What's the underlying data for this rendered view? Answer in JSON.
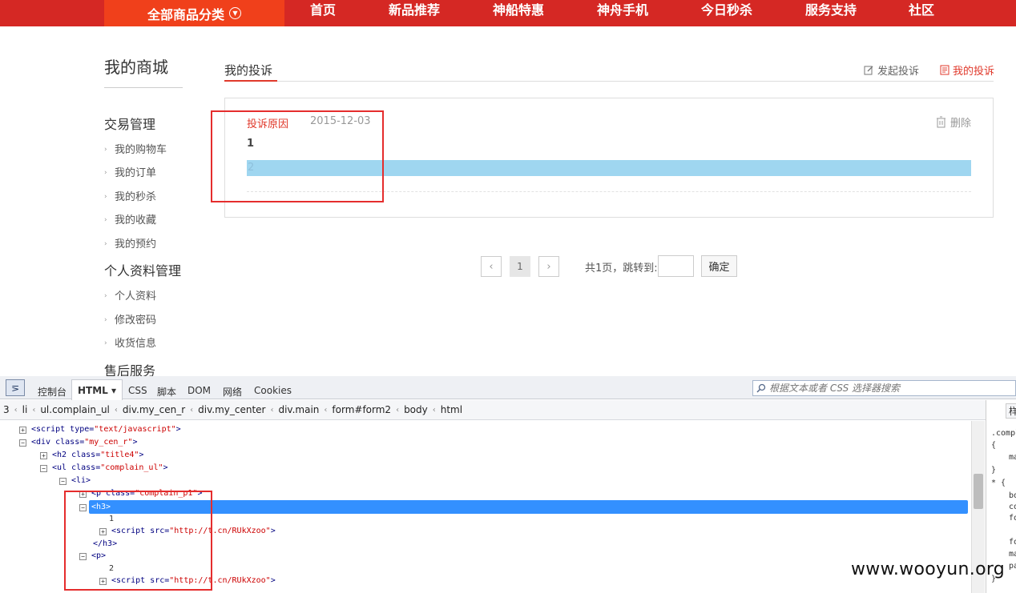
{
  "topnav": {
    "category_label": "全部商品分类",
    "items": [
      "首页",
      "新品推荐",
      "神船特惠",
      "神舟手机",
      "今日秒杀",
      "服务支持",
      "社区"
    ]
  },
  "sidebar": {
    "title": "我的商城",
    "groups": [
      {
        "title": "交易管理",
        "items": [
          "我的购物车",
          "我的订单",
          "我的秒杀",
          "我的收藏",
          "我的预约"
        ]
      },
      {
        "title": "个人资料管理",
        "items": [
          "个人资料",
          "修改密码",
          "收货信息"
        ]
      },
      {
        "title": "售后服务",
        "items": []
      }
    ]
  },
  "main": {
    "title": "我的投诉",
    "actions": {
      "create": "发起投诉",
      "mine": "我的投诉"
    },
    "complaint": {
      "reason_label": "投诉原因",
      "date": "2015-12-03",
      "delete_label": "删除",
      "h3_text": "1",
      "p_text": "2"
    }
  },
  "pagination": {
    "prev": "‹",
    "next": "›",
    "current": "1",
    "info": "共1页，跳转到:",
    "go_label": "确定"
  },
  "devtools": {
    "tabs": [
      "控制台",
      "HTML",
      "CSS",
      "脚本",
      "DOM",
      "网络",
      "Cookies"
    ],
    "active_tab": "HTML",
    "search_placeholder": "根据文本或者 CSS 选择器搜索",
    "breadcrumb": [
      "3",
      "li",
      "ul.complain_ul",
      "div.my_cen_r",
      "div.my_center",
      "div.main",
      "form#form2",
      "body",
      "html"
    ],
    "tree": {
      "l1": {
        "tag": "<script ",
        "attr": "type=",
        "val": "\"text/javascript\"",
        "close": ">"
      },
      "l2": {
        "tag": "<div ",
        "attr": "class=",
        "val": "\"my_cen_r\"",
        "close": ">"
      },
      "l3": {
        "tag": "<h2 ",
        "attr": "class=",
        "val": "\"title4\"",
        "close": ">"
      },
      "l4": {
        "tag": "<ul ",
        "attr": "class=",
        "val": "\"complain_ul\"",
        "close": ">"
      },
      "l5": {
        "tag": "<li>"
      },
      "l6": {
        "tag": "<p ",
        "attr": "class=",
        "val": "\"complain_p1\"",
        "close": ">"
      },
      "l7": {
        "tag": "<h3>"
      },
      "l8": {
        "text": "1"
      },
      "l9": {
        "tag": "<script ",
        "attr": "src=",
        "val": "\"http://t.cn/RUkXzoo\"",
        "close": ">"
      },
      "l10": {
        "tag": "</h3>"
      },
      "l11": {
        "tag": "<p>"
      },
      "l12": {
        "text": "2"
      },
      "l13": {
        "tag": "<script ",
        "attr": "src=",
        "val": "\"http://t.cn/RUkXzoo\"",
        "close": ">"
      }
    },
    "css_panel": [
      ".compl",
      "{",
      "ma",
      "}",
      "* {",
      "bo",
      "co",
      "fo",
      "fo",
      "ma",
      "pa",
      "}"
    ],
    "css_tab_label": "样"
  },
  "watermark": "www.wooyun.org",
  "colors": {
    "nav_red": "#d52824",
    "category_orange": "#f0401b",
    "accent_red": "#e0392b",
    "selection_blue": "#3390ff"
  }
}
